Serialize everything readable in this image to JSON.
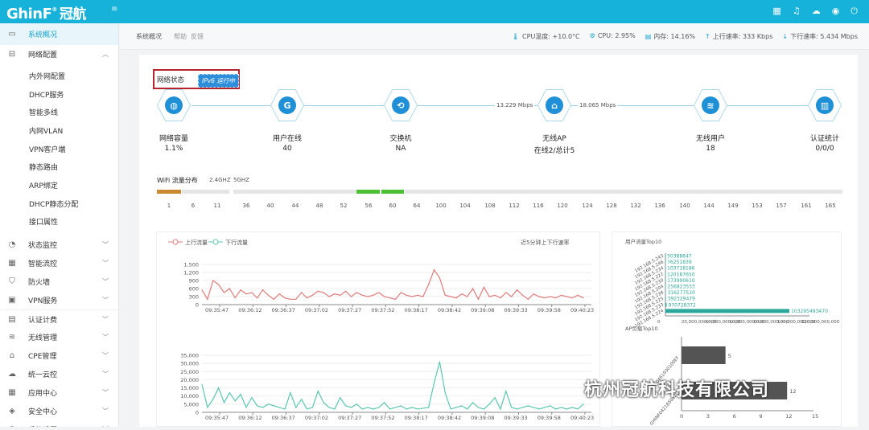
{
  "app": {
    "brand": "GhinF",
    "brand_sup": "®",
    "brand_cn": "冠航",
    "collapse": "≡"
  },
  "topicons": [
    "grid-icon",
    "bell-icon",
    "cloud-icon",
    "globe-icon",
    "power-icon"
  ],
  "sidebar": {
    "items": [
      {
        "label": "系统概况",
        "icon": "monitor-icon",
        "active": true
      },
      {
        "label": "网络配置",
        "icon": "network-icon",
        "arrow": "up"
      },
      {
        "label": "状态监控",
        "icon": "dashboard-icon",
        "arrow": "down"
      },
      {
        "label": "智能流控",
        "icon": "flow-icon",
        "arrow": "down"
      },
      {
        "label": "防火墙",
        "icon": "shield-icon",
        "arrow": "down"
      },
      {
        "label": "VPN服务",
        "icon": "vpn-icon",
        "arrow": "down"
      },
      {
        "label": "认证计费",
        "icon": "auth-icon",
        "arrow": "down"
      },
      {
        "label": "无线管理",
        "icon": "wifi-icon",
        "arrow": "down"
      },
      {
        "label": "CPE管理",
        "icon": "cpe-icon",
        "arrow": "down"
      },
      {
        "label": "统一云控",
        "icon": "cloud-icon",
        "arrow": "down"
      },
      {
        "label": "应用中心",
        "icon": "apps-icon",
        "arrow": "down"
      },
      {
        "label": "安全中心",
        "icon": "security-icon",
        "arrow": "down"
      },
      {
        "label": "系统设置",
        "icon": "settings-icon",
        "arrow": "down"
      }
    ],
    "subitems": [
      "内外网配置",
      "DHCP服务",
      "智能多线",
      "内网VLAN",
      "VPN客户端",
      "静态路由",
      "ARP绑定",
      "DHCP静态分配",
      "接口属性"
    ]
  },
  "crumb": {
    "c1": "系统概况",
    "c2": "帮助",
    "c3": "反馈"
  },
  "stats": {
    "cpu_temp": "CPU温度: +10.0°C",
    "cpu": "CPU: 2.95%",
    "mem": "内存: 14.16%",
    "up": "上行速率: 333 Kbps",
    "down": "下行速率: 5.434 Mbps"
  },
  "net": {
    "label": "网络状态",
    "ipv6": "IPv6 运行中",
    "nodes": [
      {
        "title": "网络容量",
        "value": "1.1%",
        "icon": "globe-icon",
        "glyph": "◍"
      },
      {
        "title": "用户在线",
        "value": "40",
        "icon": "user-shield-icon",
        "glyph": "G"
      },
      {
        "title": "交换机",
        "value": "NA",
        "icon": "switch-icon",
        "glyph": "⟲"
      },
      {
        "title": "无线AP",
        "value": "在线2/总计5",
        "icon": "ap-icon",
        "glyph": "⌂"
      },
      {
        "title": "无线用户",
        "value": "18",
        "icon": "wifi-icon",
        "glyph": "≋"
      },
      {
        "title": "认证统计",
        "value": "0/0/0",
        "icon": "bar-chart-icon",
        "glyph": "▥"
      }
    ],
    "speed_left": "13.229 Mbps",
    "speed_right": "18.065 Mbps"
  },
  "wifi": {
    "title": "WiFi 流量分布",
    "band1": "2.4GHZ",
    "band2": "5GHZ",
    "channels": [
      "1",
      "6",
      "11",
      "36",
      "40",
      "44",
      "48",
      "52",
      "56",
      "60",
      "64",
      "100",
      "104",
      "108",
      "112",
      "116",
      "120",
      "124",
      "128",
      "132",
      "136",
      "140",
      "144",
      "149",
      "153",
      "157",
      "161",
      "165"
    ]
  },
  "traffic": {
    "legend_up": "上行流量",
    "legend_down": "下行流量",
    "note": "近5分钟上下行速率",
    "colors": {
      "up": "#e07c7c",
      "down": "#5cc7b0"
    },
    "times": [
      "09:35:47",
      "09:36:12",
      "09:36:37",
      "09:37:02",
      "09:37:27",
      "09:37:52",
      "09:38:17",
      "09:38:42",
      "09:39:08",
      "09:39:33",
      "09:39:58",
      "09:40:23"
    ]
  },
  "chart_data": [
    {
      "type": "line",
      "title": "",
      "series": [
        {
          "name": "上行流量",
          "values": [
            550,
            200,
            900,
            750,
            450,
            600,
            250,
            550,
            400,
            450,
            250,
            550,
            350,
            200,
            400,
            250,
            200,
            200,
            450,
            250,
            350,
            500,
            450,
            300,
            400,
            350,
            500,
            300,
            450,
            350,
            300,
            350,
            450,
            300,
            250,
            200,
            450,
            350,
            300,
            350,
            300,
            750,
            1300,
            1000,
            350,
            300,
            250,
            400,
            300,
            600,
            200,
            650,
            300,
            350,
            250,
            450,
            300,
            550,
            350,
            200,
            400,
            300,
            250,
            300,
            250,
            350,
            300,
            250,
            350,
            250
          ]
        }
      ],
      "ylim": [
        0,
        1500
      ],
      "yticks": [
        "0",
        "300",
        "600",
        "900",
        "1,200",
        "1,500"
      ]
    },
    {
      "type": "line",
      "title": "",
      "series": [
        {
          "name": "下行流量",
          "values": [
            17000,
            3000,
            8000,
            15000,
            6000,
            12000,
            7000,
            11000,
            3000,
            9000,
            4000,
            3000,
            5000,
            4000,
            3000,
            2000,
            12000,
            3000,
            8000,
            2000,
            3000,
            13000,
            6000,
            3000,
            2000,
            9000,
            4000,
            3000,
            5000,
            2000,
            3000,
            2000,
            3000,
            6000,
            2000,
            3000,
            4000,
            2000,
            3000,
            2000,
            2500,
            3000,
            18000,
            31000,
            12000,
            2000,
            3000,
            4000,
            2000,
            6000,
            3000,
            2000,
            5000,
            9000,
            2000,
            13000,
            3000,
            2000,
            3000,
            4000,
            3000,
            2000,
            3000,
            4000,
            2000,
            3000,
            2000,
            3000,
            2000,
            5000
          ]
        }
      ],
      "ylim": [
        0,
        35000
      ],
      "yticks": [
        "0",
        "5,000",
        "10,000",
        "15,000",
        "20,000",
        "25,000",
        "30,000",
        "35,000"
      ]
    },
    {
      "type": "bar",
      "title": "用户流量Top10",
      "categories": [
        "192.168.5.243",
        "192.168.5.246",
        "192.168.5.234",
        "192.168.5.222",
        "192.168.5.230",
        "192.168.5.204",
        "192.168.5.238",
        "192.168.5.225",
        "192.168.5.233",
        "192.168.5.224"
      ],
      "values": [
        50388847,
        76251839,
        103718186,
        120187650,
        173990610,
        256823533,
        316277510,
        392329479,
        970728372,
        103295493470
      ],
      "xticks": [
        "0",
        "20,000,000,000",
        "40,000,000,000",
        "60,000,000,000",
        "80,000,000,000",
        "100,000,000,000",
        "120,000,000,000"
      ]
    },
    {
      "type": "bar",
      "title": "AP负载Top10",
      "categories": [
        "GHINF0461930100EF",
        "GHINF042185082C"
      ],
      "values": [
        5,
        12
      ],
      "xticks": [
        "0",
        "3",
        "6",
        "9",
        "12",
        "15"
      ],
      "xlim": [
        0,
        15
      ]
    }
  ],
  "watermark": "杭州冠航科技有限公司"
}
